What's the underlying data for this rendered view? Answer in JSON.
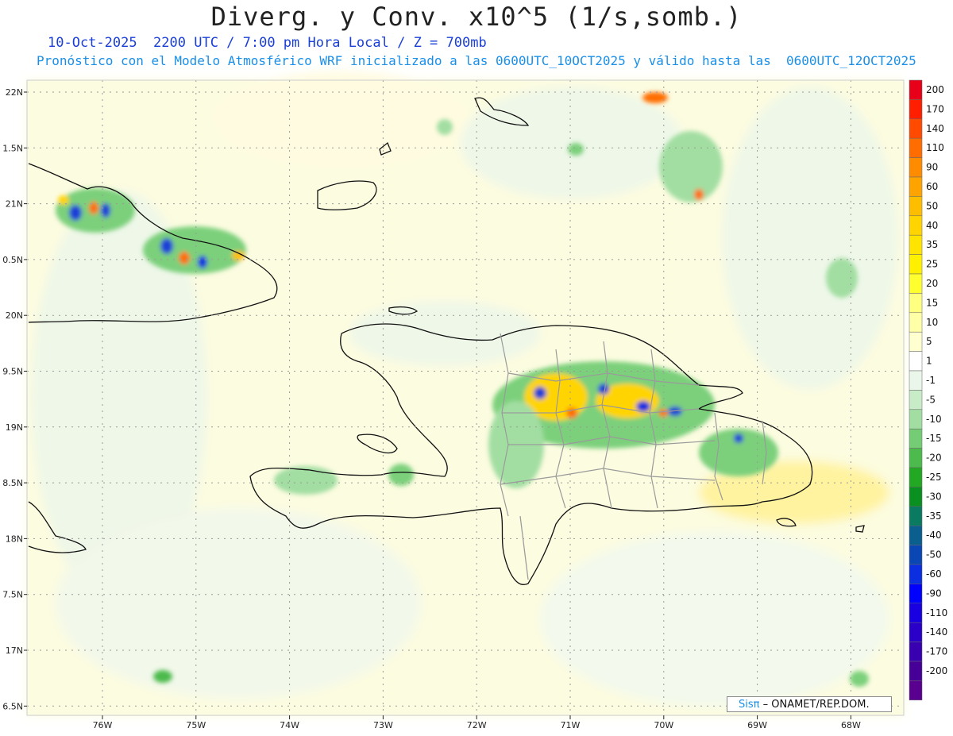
{
  "title": "Diverg. y Conv. x10^5 (1/s,somb.)",
  "subtitle_line1": "10-Oct-2025  2200 UTC / 7:00 pm Hora Local / Z = 700mb",
  "subtitle_line2": "Pronóstico con el Modelo Atmosférico WRF inicializado a las 0600UTC_10OCT2025 y válido hasta las  0600UTC_12OCT2025",
  "lat_labels": [
    "22N",
    "1.5N",
    "21N",
    "0.5N",
    "20N",
    "9.5N",
    "19N",
    "8.5N",
    "18N",
    "7.5N",
    "17N",
    "6.5N"
  ],
  "lon_labels": [
    "76W",
    "75W",
    "74W",
    "73W",
    "72W",
    "71W",
    "70W",
    "69W",
    "68W"
  ],
  "colorbar": [
    {
      "label": "200",
      "color": "#e8001a"
    },
    {
      "label": "170",
      "color": "#ff1f00"
    },
    {
      "label": "140",
      "color": "#ff4a00"
    },
    {
      "label": "110",
      "color": "#ff6d00"
    },
    {
      "label": "90",
      "color": "#ff8c00"
    },
    {
      "label": "60",
      "color": "#ffa300"
    },
    {
      "label": "50",
      "color": "#ffbd00"
    },
    {
      "label": "40",
      "color": "#ffd400"
    },
    {
      "label": "35",
      "color": "#ffe400"
    },
    {
      "label": "25",
      "color": "#fff000"
    },
    {
      "label": "20",
      "color": "#ffff30"
    },
    {
      "label": "15",
      "color": "#ffff80"
    },
    {
      "label": "10",
      "color": "#ffffa8"
    },
    {
      "label": "5",
      "color": "#ffffd0"
    },
    {
      "label": "1",
      "color": "#ffffff"
    },
    {
      "label": "-1",
      "color": "#eaf6ea"
    },
    {
      "label": "-5",
      "color": "#c8ecc8"
    },
    {
      "label": "-10",
      "color": "#a2dea2"
    },
    {
      "label": "-15",
      "color": "#74cc74"
    },
    {
      "label": "-20",
      "color": "#4cba4c"
    },
    {
      "label": "-25",
      "color": "#22a822"
    },
    {
      "label": "-30",
      "color": "#0a9020"
    },
    {
      "label": "-35",
      "color": "#0a7a60"
    },
    {
      "label": "-40",
      "color": "#0a5f8f"
    },
    {
      "label": "-50",
      "color": "#0a46b4"
    },
    {
      "label": "-60",
      "color": "#0a2ee0"
    },
    {
      "label": "-90",
      "color": "#0000ff"
    },
    {
      "label": "-110",
      "color": "#1800e0"
    },
    {
      "label": "-140",
      "color": "#2a00c8"
    },
    {
      "label": "-170",
      "color": "#3800b0"
    },
    {
      "label": "-200",
      "color": "#460098"
    },
    {
      "label": "",
      "color": "#5a0090"
    }
  ],
  "credit_brand": "Sisπ",
  "credit_org": "– ONAMET/REP.DOM."
}
